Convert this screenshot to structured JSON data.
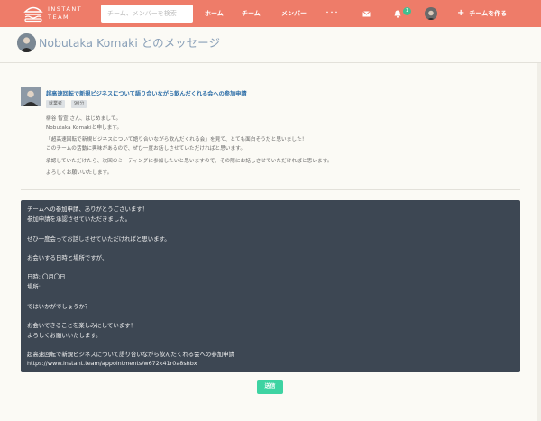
{
  "navbar": {
    "brand_line1": "INSTANT",
    "brand_line2": "TEAM",
    "search_placeholder": "チーム、メンバーを検索",
    "nav_home": "ホーム",
    "nav_team": "チーム",
    "nav_member": "メンバー",
    "nav_more": "・・・",
    "notification_count": "1",
    "create_team": "チームを作る",
    "icons": {
      "logo": "burger-logo-icon",
      "mail": "mail-icon",
      "bell": "bell-icon",
      "plus": "plus-icon"
    },
    "color": "#ee7c69"
  },
  "header": {
    "title": "Nobutaka Komaki とのメッセージ"
  },
  "message": {
    "title": "超高速回転で新規ビジネスについて語り合いながら飲んだくれる会への参加申請",
    "tags": [
      "就業者",
      "90分"
    ],
    "body": [
      "柳谷 智宣 さん、はじめまして。",
      "Nobutaka Komakiと申します。",
      "「超高速回転で新規ビジネスについて語り合いながら飲んだくれる会」を見て、とても面白そうだと思いました！",
      "このチームの活動に興味があるので、ぜひ一度お話しさせていただければと思います。",
      "承認していただけたら、次回のミーティングに参加したいと思いますので、その際にお話しさせていただければと思います。",
      "よろしくお願いいたします。"
    ]
  },
  "reply": {
    "lines": [
      "チームへの参加申請、ありがとうございます！",
      "参加申請を承認させていただきました。",
      "",
      "ぜひ一度会ってお話しさせていただければと思います。",
      "",
      "お会いする日時と場所ですが、",
      "",
      "日時: 〇月〇日",
      "場所:",
      "",
      "ではいかがでしょうか？",
      "",
      "お会いできることを楽しみにしています！",
      "よろしくお願いいたします。",
      "",
      "超高速回転で新規ビジネスについて語り合いながら飲んだくれる会への参加申請",
      "https://www.instant.team/appointments/w672k41r0a8shbx"
    ],
    "background": "#3d4753"
  },
  "send_button": "送信",
  "accent_color": "#3ed3a2"
}
